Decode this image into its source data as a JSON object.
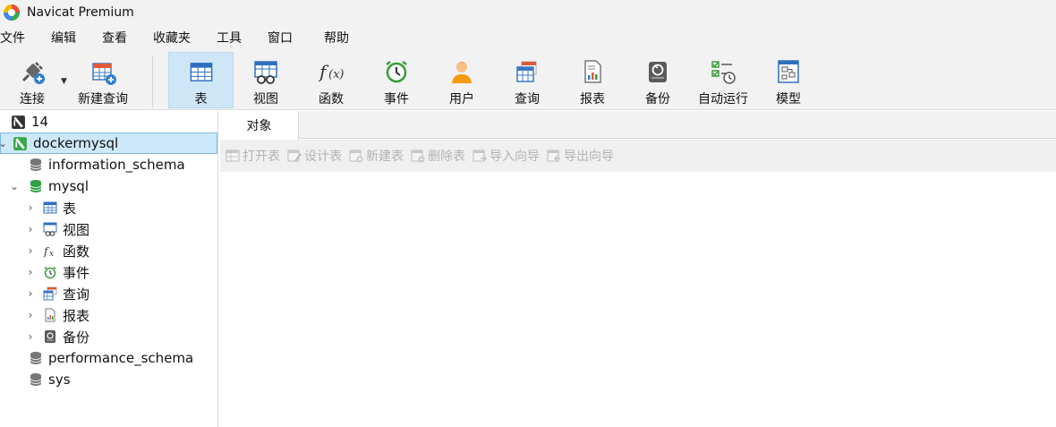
{
  "window": {
    "title": "Navicat Premium"
  },
  "menu": [
    "文件",
    "编辑",
    "查看",
    "收藏夹",
    "工具",
    "窗口",
    "帮助"
  ],
  "toolbar": {
    "connect": "连接",
    "new_query": "新建查询",
    "table": "表",
    "view": "视图",
    "function": "函数",
    "event": "事件",
    "user": "用户",
    "query": "查询",
    "report": "报表",
    "backup": "备份",
    "automation": "自动运行",
    "model": "模型"
  },
  "tree": {
    "root": "14",
    "connection": "dockermysql",
    "databases": {
      "information_schema": "information_schema",
      "mysql": "mysql",
      "performance_schema": "performance_schema",
      "sys": "sys"
    },
    "mysql_children": {
      "tables": "表",
      "views": "视图",
      "functions": "函数",
      "events": "事件",
      "queries": "查询",
      "reports": "报表",
      "backups": "备份"
    }
  },
  "main": {
    "tab": "对象",
    "actions": {
      "open_table": "打开表",
      "design_table": "设计表",
      "new_table": "新建表",
      "delete_table": "删除表",
      "import_wizard": "导入向导",
      "export_wizard": "导出向导"
    }
  }
}
